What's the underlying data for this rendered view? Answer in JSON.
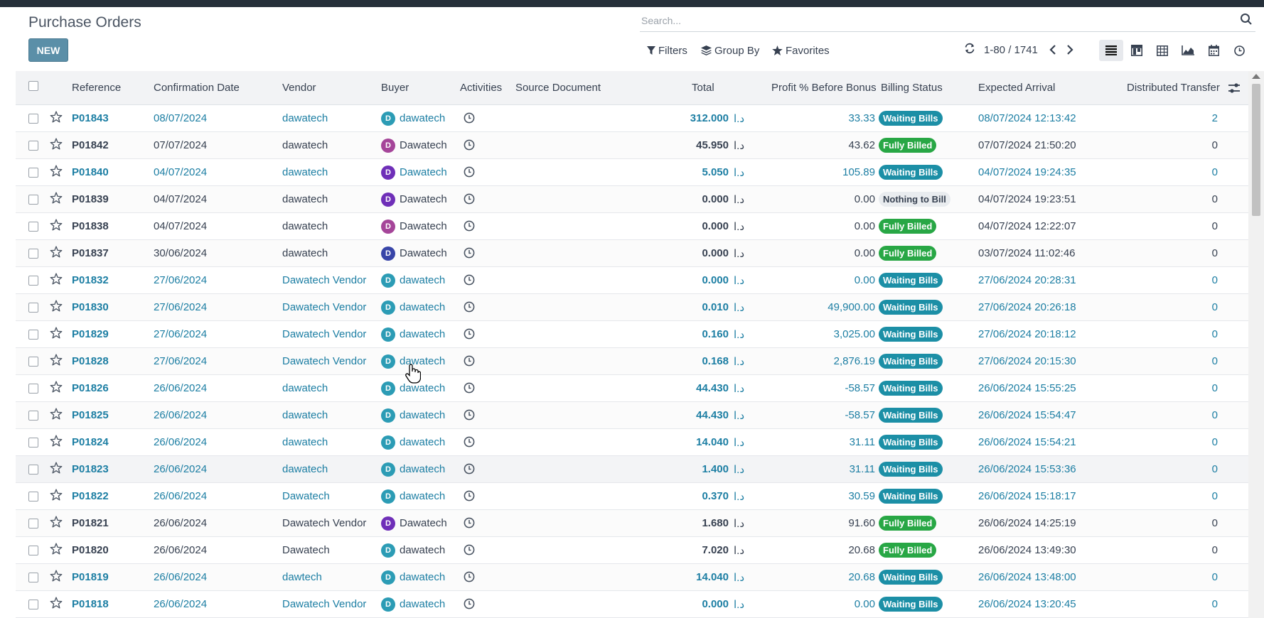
{
  "header": {
    "title": "Purchase Orders",
    "new_label": "NEW",
    "search_placeholder": "Search..."
  },
  "control_panel": {
    "filters_label": "Filters",
    "group_by_label": "Group By",
    "favorites_label": "Favorites",
    "pager_text": "1-80 / 1741",
    "views": [
      "list-view",
      "kanban-view",
      "pivot-view",
      "graph-view",
      "calendar-view",
      "activity-view"
    ],
    "active_view": "list-view"
  },
  "columns": {
    "reference": "Reference",
    "confirmation_date": "Confirmation Date",
    "vendor": "Vendor",
    "buyer": "Buyer",
    "activities": "Activities",
    "source_document": "Source Document",
    "total": "Total",
    "profit": "Profit % Before Bonus",
    "billing_status": "Billing Status",
    "expected_arrival": "Expected Arrival",
    "distributed_transfer": "Distributed Transfer"
  },
  "currency_symbol": "د.ا",
  "colors": {
    "link_blue": "#1c7ea3",
    "waiting_bills": "#1c8fa6",
    "fully_billed": "#28a745",
    "nothing_to_bill": "#e9ecef",
    "avatar_teal": "#2c9cb5",
    "avatar_magenta": "#a54599",
    "avatar_purple": "#6f2fb8",
    "avatar_navy": "#3845a8",
    "new_button": "#5b8fa8"
  },
  "rows": [
    {
      "reference": "P01843",
      "date": "08/07/2024",
      "vendor": "dawatech",
      "buyer": "dawatech",
      "buyer_initial": "D",
      "avatar_color": "#2c9cb5",
      "total": "312.000",
      "profit": "33.33",
      "billing": "Waiting Bills",
      "arrival": "08/07/2024 12:13:42",
      "transfer": "2",
      "style": "blue"
    },
    {
      "reference": "P01842",
      "date": "07/07/2024",
      "vendor": "dawatech",
      "buyer": "Dawatech",
      "buyer_initial": "D",
      "avatar_color": "#a54599",
      "total": "45.950",
      "profit": "43.62",
      "billing": "Fully Billed",
      "arrival": "07/07/2024 21:50:20",
      "transfer": "0",
      "style": "dark"
    },
    {
      "reference": "P01840",
      "date": "04/07/2024",
      "vendor": "dawatech",
      "buyer": "Dawatech",
      "buyer_initial": "D",
      "avatar_color": "#6f2fb8",
      "total": "5.050",
      "profit": "105.89",
      "billing": "Waiting Bills",
      "arrival": "04/07/2024 19:24:35",
      "transfer": "0",
      "style": "blue"
    },
    {
      "reference": "P01839",
      "date": "04/07/2024",
      "vendor": "dawatech",
      "buyer": "Dawatech",
      "buyer_initial": "D",
      "avatar_color": "#6f2fb8",
      "total": "0.000",
      "profit": "0.00",
      "billing": "Nothing to Bill",
      "arrival": "04/07/2024 19:23:51",
      "transfer": "0",
      "style": "dark"
    },
    {
      "reference": "P01838",
      "date": "04/07/2024",
      "vendor": "dawatech",
      "buyer": "Dawatech",
      "buyer_initial": "D",
      "avatar_color": "#a54599",
      "total": "0.000",
      "profit": "0.00",
      "billing": "Fully Billed",
      "arrival": "04/07/2024 12:22:07",
      "transfer": "0",
      "style": "dark"
    },
    {
      "reference": "P01837",
      "date": "30/06/2024",
      "vendor": "dawatech",
      "buyer": "Dawatech",
      "buyer_initial": "D",
      "avatar_color": "#3845a8",
      "total": "0.000",
      "profit": "0.00",
      "billing": "Fully Billed",
      "arrival": "03/07/2024 11:02:46",
      "transfer": "0",
      "style": "dark"
    },
    {
      "reference": "P01832",
      "date": "27/06/2024",
      "vendor": "Dawatech Vendor",
      "buyer": "dawatech",
      "buyer_initial": "D",
      "avatar_color": "#2c9cb5",
      "total": "0.000",
      "profit": "0.00",
      "billing": "Waiting Bills",
      "arrival": "27/06/2024 20:28:31",
      "transfer": "0",
      "style": "blue"
    },
    {
      "reference": "P01830",
      "date": "27/06/2024",
      "vendor": "Dawatech Vendor",
      "buyer": "dawatech",
      "buyer_initial": "D",
      "avatar_color": "#2c9cb5",
      "total": "0.010",
      "profit": "49,900.00",
      "billing": "Waiting Bills",
      "arrival": "27/06/2024 20:26:18",
      "transfer": "0",
      "style": "blue"
    },
    {
      "reference": "P01829",
      "date": "27/06/2024",
      "vendor": "Dawatech Vendor",
      "buyer": "dawatech",
      "buyer_initial": "D",
      "avatar_color": "#2c9cb5",
      "total": "0.160",
      "profit": "3,025.00",
      "billing": "Waiting Bills",
      "arrival": "27/06/2024 20:18:12",
      "transfer": "0",
      "style": "blue"
    },
    {
      "reference": "P01828",
      "date": "27/06/2024",
      "vendor": "Dawatech Vendor",
      "buyer": "dawatech",
      "buyer_initial": "D",
      "avatar_color": "#2c9cb5",
      "total": "0.168",
      "profit": "2,876.19",
      "billing": "Waiting Bills",
      "arrival": "27/06/2024 20:15:30",
      "transfer": "0",
      "style": "blue"
    },
    {
      "reference": "P01826",
      "date": "26/06/2024",
      "vendor": "dawatech",
      "buyer": "dawatech",
      "buyer_initial": "D",
      "avatar_color": "#2c9cb5",
      "total": "44.430",
      "profit": "-58.57",
      "billing": "Waiting Bills",
      "arrival": "26/06/2024 15:55:25",
      "transfer": "0",
      "style": "blue"
    },
    {
      "reference": "P01825",
      "date": "26/06/2024",
      "vendor": "dawatech",
      "buyer": "dawatech",
      "buyer_initial": "D",
      "avatar_color": "#2c9cb5",
      "total": "44.430",
      "profit": "-58.57",
      "billing": "Waiting Bills",
      "arrival": "26/06/2024 15:54:47",
      "transfer": "0",
      "style": "blue"
    },
    {
      "reference": "P01824",
      "date": "26/06/2024",
      "vendor": "dawatech",
      "buyer": "dawatech",
      "buyer_initial": "D",
      "avatar_color": "#2c9cb5",
      "total": "14.040",
      "profit": "31.11",
      "billing": "Waiting Bills",
      "arrival": "26/06/2024 15:54:21",
      "transfer": "0",
      "style": "blue"
    },
    {
      "reference": "P01823",
      "date": "26/06/2024",
      "vendor": "dawatech",
      "buyer": "dawatech",
      "buyer_initial": "D",
      "avatar_color": "#2c9cb5",
      "total": "1.400",
      "profit": "31.11",
      "billing": "Waiting Bills",
      "arrival": "26/06/2024 15:53:36",
      "transfer": "0",
      "style": "blue",
      "highlight": true
    },
    {
      "reference": "P01822",
      "date": "26/06/2024",
      "vendor": "Dawatech",
      "buyer": "dawatech",
      "buyer_initial": "D",
      "avatar_color": "#2c9cb5",
      "total": "0.370",
      "profit": "30.59",
      "billing": "Waiting Bills",
      "arrival": "26/06/2024 15:18:17",
      "transfer": "0",
      "style": "blue"
    },
    {
      "reference": "P01821",
      "date": "26/06/2024",
      "vendor": "Dawatech Vendor",
      "buyer": "Dawatech",
      "buyer_initial": "D",
      "avatar_color": "#6f2fb8",
      "total": "1.680",
      "profit": "91.60",
      "billing": "Fully Billed",
      "arrival": "26/06/2024 14:25:19",
      "transfer": "0",
      "style": "dark"
    },
    {
      "reference": "P01820",
      "date": "26/06/2024",
      "vendor": "Dawatech",
      "buyer": "dawatech",
      "buyer_initial": "D",
      "avatar_color": "#2c9cb5",
      "total": "7.020",
      "profit": "20.68",
      "billing": "Fully Billed",
      "arrival": "26/06/2024 13:49:30",
      "transfer": "0",
      "style": "dark"
    },
    {
      "reference": "P01819",
      "date": "26/06/2024",
      "vendor": "dawtech",
      "buyer": "dawatech",
      "buyer_initial": "D",
      "avatar_color": "#2c9cb5",
      "total": "14.040",
      "profit": "20.68",
      "billing": "Waiting Bills",
      "arrival": "26/06/2024 13:48:00",
      "transfer": "0",
      "style": "blue"
    },
    {
      "reference": "P01818",
      "date": "26/06/2024",
      "vendor": "Dawatech Vendor",
      "buyer": "dawatech",
      "buyer_initial": "D",
      "avatar_color": "#2c9cb5",
      "total": "0.000",
      "profit": "0.00",
      "billing": "Waiting Bills",
      "arrival": "26/06/2024 13:20:45",
      "transfer": "0",
      "style": "blue"
    }
  ]
}
